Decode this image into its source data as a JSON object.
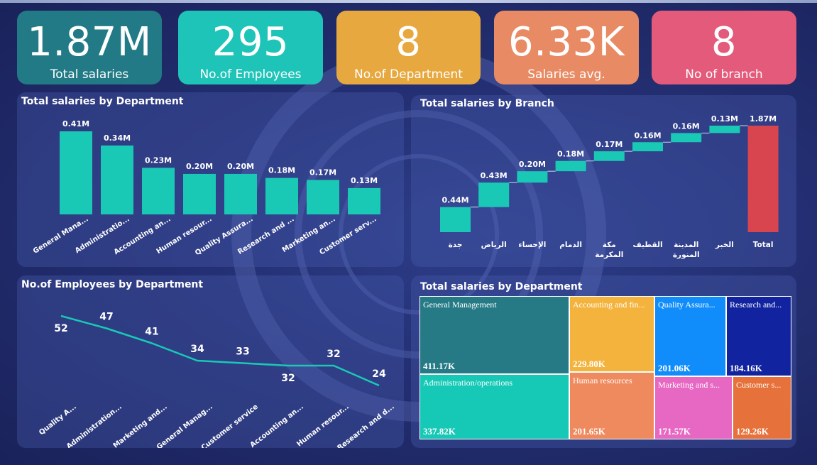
{
  "kpis": [
    {
      "value": "1.87M",
      "label": "Total salaries",
      "color": "#217a86"
    },
    {
      "value": "295",
      "label": "No.of Employees",
      "color": "#1fc4b8"
    },
    {
      "value": "8",
      "label": "No.of Department",
      "color": "#e7a83f"
    },
    {
      "value": "6.33K",
      "label": "Salaries avg.",
      "color": "#e88a63"
    },
    {
      "value": "8",
      "label": "No of branch",
      "color": "#e35a7a"
    }
  ],
  "chart_data": [
    {
      "type": "bar",
      "title": "Total salaries by Department",
      "categories": [
        "General Mana...",
        "Administratio...",
        "Accounting an...",
        "Human resour...",
        "Quality Assura...",
        "Research and ...",
        "Marketing an...",
        "Customer serv..."
      ],
      "values": [
        0.41,
        0.34,
        0.23,
        0.2,
        0.2,
        0.18,
        0.17,
        0.13
      ],
      "data_labels": [
        "0.41M",
        "0.34M",
        "0.23M",
        "0.20M",
        "0.20M",
        "0.18M",
        "0.17M",
        "0.13M"
      ],
      "color": "#19c9b6"
    },
    {
      "type": "waterfall",
      "title": "Total salaries by Branch",
      "categories": [
        "جدة",
        "الرياض",
        "الإحساء",
        "الدمام",
        "مكة المكرمة",
        "القطيف",
        "المدينة المنورة",
        "الخبر",
        "Total"
      ],
      "values": [
        0.44,
        0.43,
        0.2,
        0.18,
        0.17,
        0.16,
        0.16,
        0.13,
        1.87
      ],
      "data_labels": [
        "0.44M",
        "0.43M",
        "0.20M",
        "0.18M",
        "0.17M",
        "0.16M",
        "0.16M",
        "0.13M",
        "1.87M"
      ],
      "color": "#19c9b6",
      "total_color": "#d9454e"
    },
    {
      "type": "line",
      "title": "No.of Employees by Department",
      "categories": [
        "Quality A...",
        "Administration...",
        "Marketing and...",
        "General Manag...",
        "Customer service",
        "Accounting an...",
        "Human resour...",
        "Research and d..."
      ],
      "values": [
        52,
        47,
        41,
        34,
        33,
        32,
        32,
        24
      ],
      "color": "#19c9b6"
    },
    {
      "type": "treemap",
      "title": "Total salaries by Department",
      "items": [
        {
          "label": "General Management",
          "value": "411.17K",
          "color": "#257a85"
        },
        {
          "label": "Administration/operations",
          "value": "337.82K",
          "color": "#16c9b6"
        },
        {
          "label": "Accounting and fin...",
          "value": "229.80K",
          "color": "#f4b33d"
        },
        {
          "label": "Human resources",
          "value": "201.65K",
          "color": "#ef8a5e"
        },
        {
          "label": "Quality Assura...",
          "value": "201.06K",
          "color": "#118dfb"
        },
        {
          "label": "Marketing and s...",
          "value": "171.57K",
          "color": "#e768c2"
        },
        {
          "label": "Research and...",
          "value": "184.16K",
          "color": "#1223a0"
        },
        {
          "label": "Customer s...",
          "value": "129.26K",
          "color": "#e6713a"
        }
      ]
    }
  ]
}
